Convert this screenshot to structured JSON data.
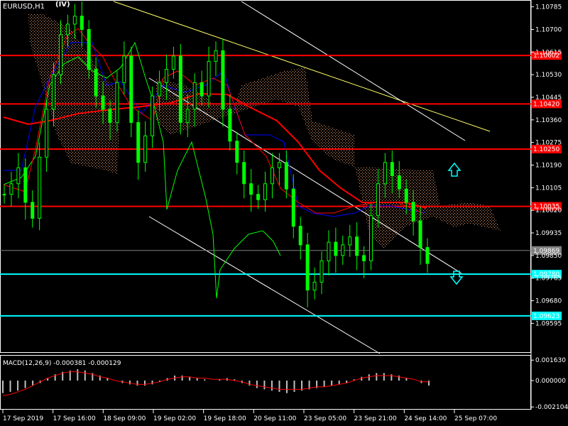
{
  "window": {
    "symbol_label": "EURUSD,H1",
    "badge": "(IV)"
  },
  "colors": {
    "background": "#000000",
    "candles": "#00ff00",
    "red_level": "#ff0000",
    "cyan_level": "#00ffff",
    "kumo": "#ffb080",
    "trend_yellow": "#ffff66",
    "channel_white": "#ffffff",
    "tenkan": "#0000ff",
    "kijun": "#ff0000",
    "ma": "#ff0000",
    "macd_hist": "#c0c0c0",
    "macd_signal": "#ff0000"
  },
  "chart_data": [
    {
      "type": "line",
      "title": "EURUSD,H1",
      "price_axis_ticks": [
        "1.10785",
        "1.10700",
        "1.10615",
        "1.10530",
        "1.10445",
        "1.10360",
        "1.10275",
        "1.10190",
        "1.10105",
        "1.10020",
        "1.09935",
        "1.09850",
        "1.09765",
        "1.09680",
        "1.09595"
      ],
      "ylim": [
        1.0954,
        1.108
      ],
      "time_axis_ticks": [
        "17 Sep 2019",
        "17 Sep 16:00",
        "18 Sep 09:00",
        "19 Sep 02:00",
        "19 Sep 18:00",
        "20 Sep 11:00",
        "23 Sep 05:00",
        "23 Sep 21:00",
        "24 Sep 14:00",
        "25 Sep 07:00"
      ],
      "price_levels": [
        {
          "label": "1.10602",
          "value": 1.10602,
          "kind": "red"
        },
        {
          "label": "1.10420",
          "value": 1.1042,
          "kind": "red"
        },
        {
          "label": "1.10250",
          "value": 1.1025,
          "kind": "red"
        },
        {
          "label": "1.10035",
          "value": 1.10035,
          "kind": "red"
        },
        {
          "label": "1.09869",
          "value": 1.09869,
          "kind": "current"
        },
        {
          "label": "1.09780",
          "value": 1.0978,
          "kind": "cyan"
        },
        {
          "label": "1.09623",
          "value": 1.09623,
          "kind": "cyan"
        }
      ],
      "series": [
        {
          "values": [
            1.1008,
            1.1012,
            1.1018,
            1.1005,
            1.0999,
            1.1022,
            1.104,
            1.1053,
            1.1068,
            1.1072,
            1.1075,
            1.107,
            1.1055,
            1.1045,
            1.104,
            1.1035,
            1.105,
            1.106,
            1.1035,
            1.102,
            1.103,
            1.1045,
            1.105,
            1.1055,
            1.106,
            1.1035,
            1.104,
            1.105,
            1.1045,
            1.1058,
            1.1062,
            1.104,
            1.1028,
            1.102,
            1.1012,
            1.1008,
            1.1006,
            1.1012,
            1.1018,
            1.102,
            1.101,
            1.0996,
            1.0989,
            1.0972,
            1.0975,
            1.0983,
            1.099,
            1.0985,
            1.0989,
            1.0992,
            1.0985,
            1.0983,
            1.1,
            1.1012,
            1.102,
            1.1015,
            1.101,
            1.1005,
            1.0998,
            1.0988,
            1.0982
          ]
        }
      ]
    },
    {
      "type": "bar",
      "title": "MACD(12,26,9) -0.000381 -0.000129",
      "ylim": [
        -0.00215,
        0.0017
      ],
      "axis_ticks": [
        "0.001630",
        "0.000000",
        "-0.002104"
      ],
      "series": [
        {
          "values": [
            -0.001,
            -0.0009,
            -0.0008,
            -0.0006,
            -0.0004,
            -0.0002,
            0.0002,
            0.0005,
            0.0007,
            0.0008,
            0.0009,
            0.0008,
            0.0006,
            0.0004,
            0.0002,
            0.0,
            -0.0002,
            -0.0003,
            -0.0004,
            -0.0004,
            -0.0003,
            -0.0001,
            0.0002,
            0.0004,
            0.0004,
            0.0003,
            0.0002,
            0.0001,
            0.0,
            0.0001,
            0.0002,
            0.0001,
            -0.0002,
            -0.0004,
            -0.0006,
            -0.0007,
            -0.0008,
            -0.0009,
            -0.001,
            -0.0009,
            -0.0008,
            -0.0007,
            -0.0006,
            -0.0005,
            -0.0004,
            -0.0003,
            -0.0002,
            0.0001,
            0.0003,
            0.0005,
            0.0006,
            0.0006,
            0.0005,
            0.0004,
            0.0002,
            0.0,
            -0.0002,
            -0.0004
          ]
        },
        {
          "values": [
            -0.0012,
            -0.0011,
            -0.0009,
            -0.0007,
            -0.0004,
            -0.0001,
            0.0002,
            0.0004,
            0.0006,
            0.0007,
            0.0007,
            0.0006,
            0.0005,
            0.0003,
            0.0002,
            0.0,
            -0.0001,
            -0.0002,
            -0.0003,
            -0.0003,
            -0.0002,
            -0.0001,
            0.0001,
            0.0002,
            0.0003,
            0.0003,
            0.0002,
            0.0002,
            0.0001,
            0.0001,
            0.0001,
            0.0,
            -0.0001,
            -0.0003,
            -0.0004,
            -0.0005,
            -0.0006,
            -0.0007,
            -0.0007,
            -0.0007,
            -0.0007,
            -0.0006,
            -0.0005,
            -0.0005,
            -0.0004,
            -0.0003,
            -0.0002,
            0.0,
            0.0002,
            0.0003,
            0.0004,
            0.0004,
            0.0004,
            0.0003,
            0.0002,
            0.0001,
            -0.0001,
            -0.0001
          ]
        }
      ]
    }
  ]
}
